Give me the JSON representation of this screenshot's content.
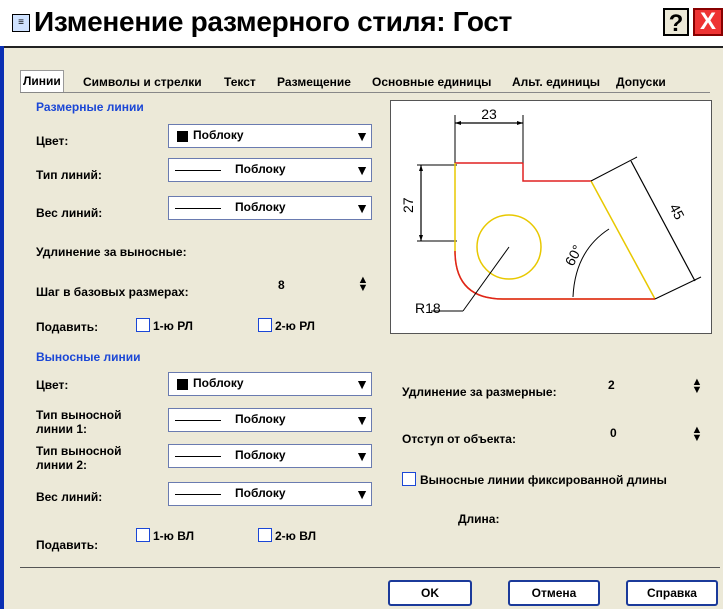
{
  "window": {
    "icon": "≡",
    "title": "Изменение размерного стиля: Гост",
    "help": "?",
    "close": "X"
  },
  "tabs": [
    "Линии",
    "Символы и стрелки",
    "Текст",
    "Размещение",
    "Основные единицы",
    "Альт. единицы",
    "Допуски"
  ],
  "dim_lines": {
    "group": "Размерные линии",
    "color_label": "Цвет:",
    "color_value": "Поблоку",
    "linetype_label": "Тип линий:",
    "linetype_value": "Поблоку",
    "lineweight_label": "Вес линий:",
    "lineweight_value": "Поблоку",
    "extend_label": "Удлинение за выносные:",
    "baseline_label": "Шаг в базовых размерах:",
    "baseline_value": "8",
    "suppress_label": "Подавить:",
    "suppress_1": "1-ю РЛ",
    "suppress_2": "2-ю РЛ"
  },
  "ext_lines": {
    "group": "Выносные линии",
    "color_label": "Цвет:",
    "color_value": "Поблоку",
    "type1_label_a": "Тип выносной",
    "type1_label_b": "линии 1:",
    "type1_value": "Поблоку",
    "type2_label_a": "Тип выносной",
    "type2_label_b": "линии 2:",
    "type2_value": "Поблоку",
    "lineweight_label": "Вес линий:",
    "lineweight_value": "Поблоку",
    "suppress_label": "Подавить:",
    "suppress_1": "1-ю ВЛ",
    "suppress_2": "2-ю ВЛ",
    "extend_label": "Удлинение за размерные:",
    "extend_value": "2",
    "offset_label": "Отступ от объекта:",
    "offset_value": "0",
    "fixed_label": "Выносные линии фиксированной длины",
    "length_label": "Длина:"
  },
  "preview": {
    "dim_top": "23",
    "dim_left": "27",
    "dim_diag": "45",
    "dim_angle": "60°",
    "dim_radius": "R18"
  },
  "buttons": {
    "ok": "OK",
    "cancel": "Отмена",
    "help": "Справка"
  },
  "colors": {
    "accent": "#1b47d6",
    "red": "#e02020",
    "yellow": "#e8c800"
  }
}
